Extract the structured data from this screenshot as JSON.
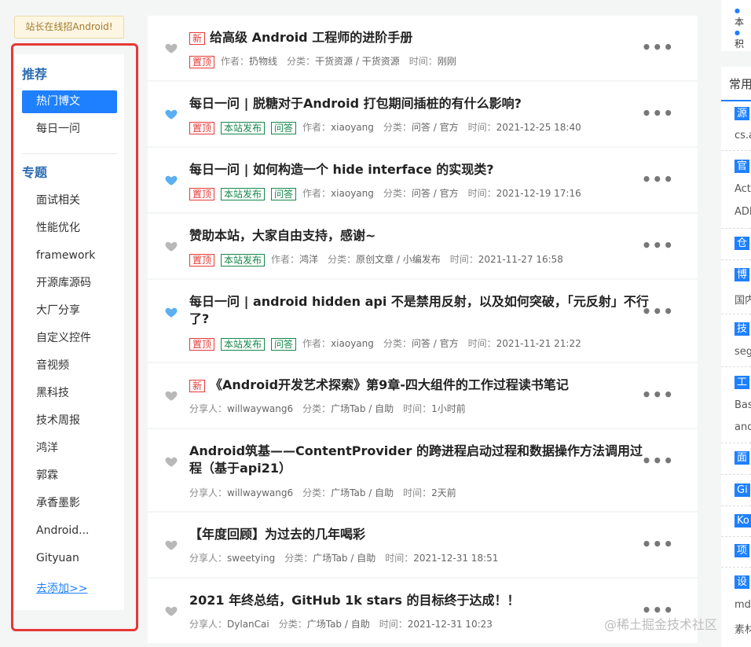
{
  "recruit_banner": "站长在线招Android!",
  "sidebar": {
    "recommend_title": "推荐",
    "recommend_items": [
      "热门博文",
      "每日一问"
    ],
    "topics_title": "专题",
    "topic_items": [
      "面试相关",
      "性能优化",
      "framework",
      "开源库源码",
      "大厂分享",
      "自定义控件",
      "音视频",
      "黑科技",
      "技术周报",
      "鸿洋",
      "郭霖",
      "承香墨影",
      "Android...",
      "Gityuan"
    ],
    "add_link": "去添加>>"
  },
  "posts": [
    {
      "badge_new": "新",
      "title": "给高级 Android 工程师的进阶手册",
      "tags": [
        {
          "text": "置顶",
          "color": "red"
        }
      ],
      "meta": [
        [
          "作者：",
          "扔物线"
        ],
        [
          "分类：",
          "干货资源 / 干货资源"
        ],
        [
          "时间：",
          "刚刚"
        ]
      ],
      "liked": false
    },
    {
      "title": "每日一问 | 脱糖对于Android 打包期间插桩的有什么影响?",
      "tags": [
        {
          "text": "置顶",
          "color": "red"
        },
        {
          "text": "本站发布",
          "color": "green"
        },
        {
          "text": "问答",
          "color": "green"
        }
      ],
      "meta": [
        [
          "作者：",
          "xiaoyang"
        ],
        [
          "分类：",
          "问答 / 官方"
        ],
        [
          "时间：",
          "2021-12-25 18:40"
        ]
      ],
      "liked": true
    },
    {
      "title": "每日一问 | 如何构造一个 hide interface 的实现类?",
      "tags": [
        {
          "text": "置顶",
          "color": "red"
        },
        {
          "text": "本站发布",
          "color": "green"
        },
        {
          "text": "问答",
          "color": "green"
        }
      ],
      "meta": [
        [
          "作者：",
          "xiaoyang"
        ],
        [
          "分类：",
          "问答 / 官方"
        ],
        [
          "时间：",
          "2021-12-19 17:16"
        ]
      ],
      "liked": true
    },
    {
      "title": "赞助本站，大家自由支持，感谢~",
      "tags": [
        {
          "text": "置顶",
          "color": "red"
        },
        {
          "text": "本站发布",
          "color": "green"
        }
      ],
      "meta": [
        [
          "作者：",
          "鸿洋"
        ],
        [
          "分类：",
          "原创文章 / 小编发布"
        ],
        [
          "时间：",
          "2021-11-27 16:58"
        ]
      ],
      "liked": false
    },
    {
      "title": "每日一问 | android hidden api 不是禁用反射，以及如何突破，「元反射」不行了?",
      "tags": [
        {
          "text": "置顶",
          "color": "red"
        },
        {
          "text": "本站发布",
          "color": "green"
        },
        {
          "text": "问答",
          "color": "green"
        }
      ],
      "meta": [
        [
          "作者：",
          "xiaoyang"
        ],
        [
          "分类：",
          "问答 / 官方"
        ],
        [
          "时间：",
          "2021-11-21 21:22"
        ]
      ],
      "liked": true
    },
    {
      "badge_new": "新",
      "title": "《Android开发艺术探索》第9章-四大组件的工作过程读书笔记",
      "tags": [],
      "meta": [
        [
          "分享人：",
          "willwaywang6"
        ],
        [
          "分类：",
          "广场Tab / 自助"
        ],
        [
          "时间：",
          "1小时前"
        ]
      ],
      "liked": false
    },
    {
      "title": "Android筑基——ContentProvider 的跨进程启动过程和数据操作方法调用过程（基于api21）",
      "tags": [],
      "meta": [
        [
          "分享人：",
          "willwaywang6"
        ],
        [
          "分类：",
          "广场Tab / 自助"
        ],
        [
          "时间：",
          "2天前"
        ]
      ],
      "liked": false
    },
    {
      "title": "【年度回顾】为过去的几年喝彩",
      "tags": [],
      "meta": [
        [
          "分享人：",
          "sweetying"
        ],
        [
          "分类：",
          "广场Tab / 自助"
        ],
        [
          "时间：",
          "2021-12-31 18:51"
        ]
      ],
      "liked": false
    },
    {
      "title": "2021 年终总结，GitHub 1k stars 的目标终于达成！！",
      "tags": [],
      "meta": [
        [
          "分享人：",
          "DylanCai"
        ],
        [
          "分类：",
          "广场Tab / 自助"
        ],
        [
          "时间：",
          "2021-12-31 10:23"
        ]
      ],
      "liked": false
    }
  ],
  "more_glyph": "•••",
  "right_top": [
    "本",
    "积"
  ],
  "right_panel": {
    "title": "常用",
    "cats": [
      "源",
      "官",
      "仓",
      "博",
      "技",
      "工",
      "面",
      "Gi",
      "Ko",
      "项",
      "设"
    ],
    "texts": [
      "cs.a",
      "Act",
      "ADI",
      "国内",
      "seg",
      "Bas",
      "and",
      "md",
      "素材"
    ]
  },
  "watermark": "@稀土掘金技术社区",
  "colors": {
    "accent": "#1e80ff",
    "tag_red": "#e53935",
    "tag_green": "#16874a",
    "heart_liked": "#5ab0f0",
    "heart_default": "#b8b8b8"
  }
}
